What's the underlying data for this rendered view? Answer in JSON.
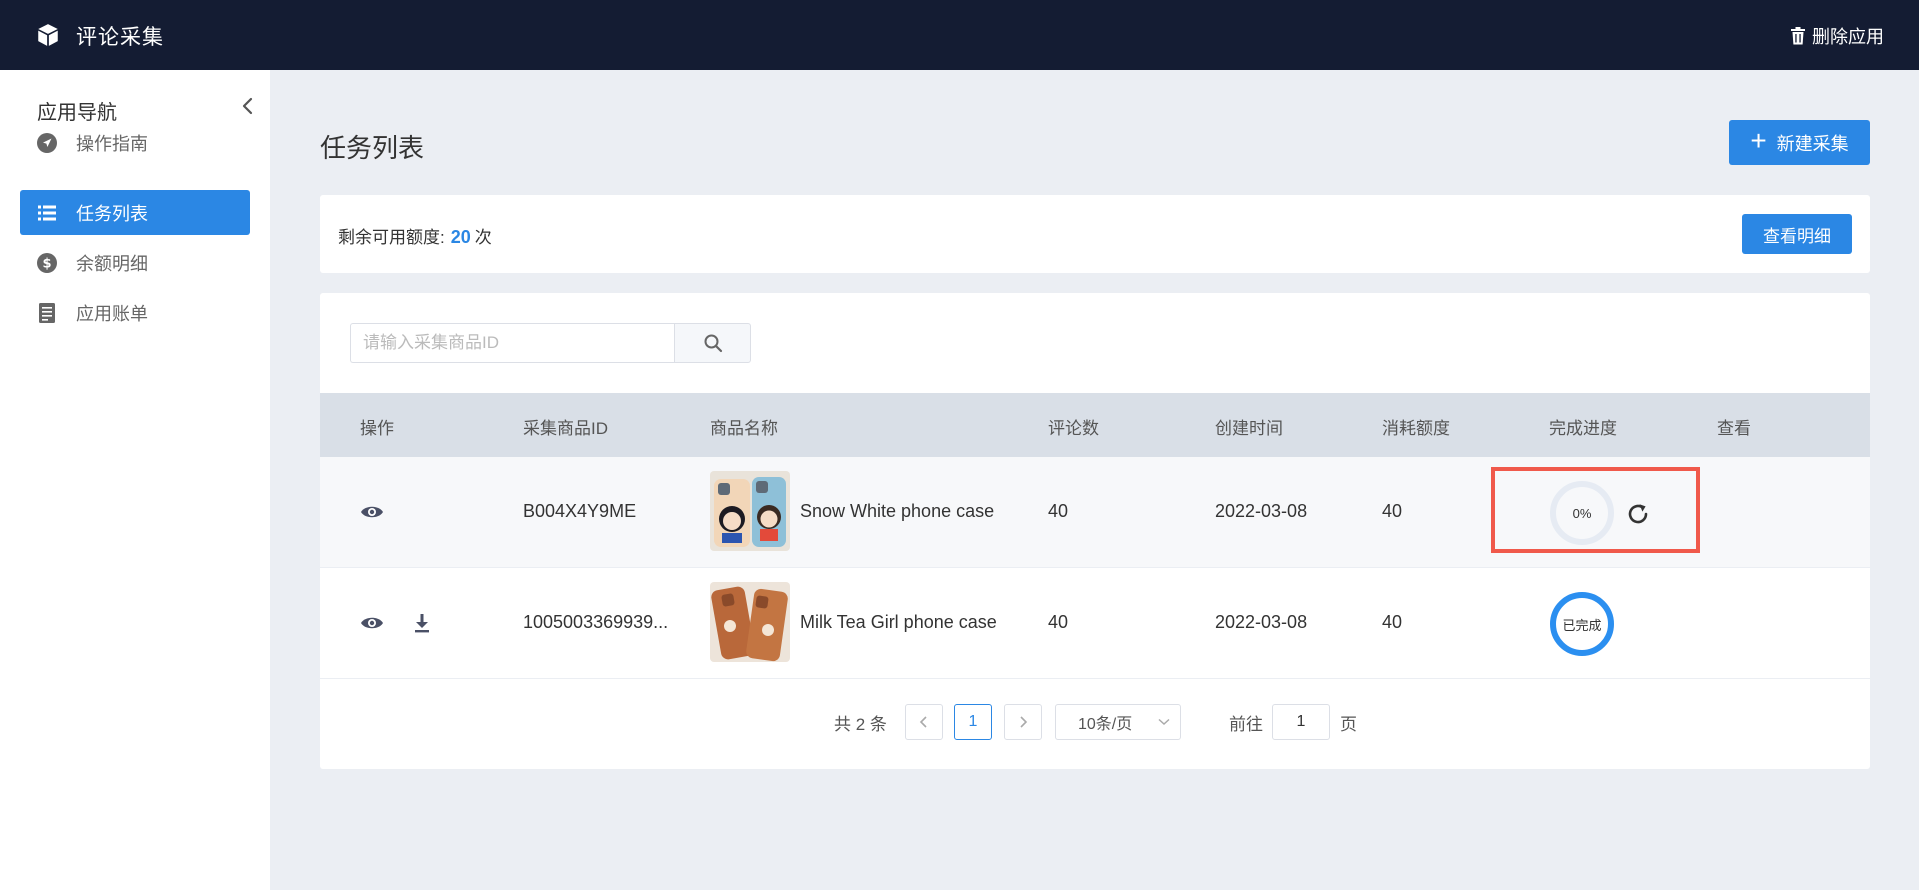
{
  "header": {
    "app_title": "评论采集",
    "delete_label": "删除应用",
    "logo_icon": "cube-icon"
  },
  "sidebar": {
    "title": "应用导航",
    "items": [
      {
        "label": "操作指南",
        "icon": "navigation-arrow-icon"
      },
      {
        "label": "任务列表",
        "icon": "list-icon",
        "active": true
      },
      {
        "label": "余额明细",
        "icon": "dollar-coin-icon"
      },
      {
        "label": "应用账单",
        "icon": "document-icon"
      }
    ]
  },
  "main": {
    "page_title": "任务列表",
    "new_button_label": "新建采集",
    "quota": {
      "label": "剩余可用额度:",
      "value": "20",
      "unit": "次",
      "detail_button": "查看明细"
    },
    "search": {
      "placeholder": "请输入采集商品ID",
      "value": ""
    },
    "table": {
      "columns": [
        "操作",
        "采集商品ID",
        "商品名称",
        "评论数",
        "创建时间",
        "消耗额度",
        "完成进度",
        "查看"
      ],
      "rows": [
        {
          "product_id": "B004X4Y9ME",
          "product_name": "Snow White phone case",
          "reviews": "40",
          "created": "2022-03-08",
          "cost": "40",
          "progress_label": "0%",
          "progress": 0,
          "actions": [
            "eye-icon"
          ]
        },
        {
          "product_id": "1005003369939...",
          "product_name": "Milk Tea Girl phone case",
          "reviews": "40",
          "created": "2022-03-08",
          "cost": "40",
          "progress_label": "已完成",
          "progress": 100,
          "actions": [
            "eye-icon",
            "download-icon"
          ]
        }
      ]
    },
    "pagination": {
      "total_label": "共 2 条",
      "current_page": "1",
      "page_size": "10条/页",
      "goto_label": "前往",
      "goto_value": "1",
      "page_unit": "页"
    }
  },
  "colors": {
    "header_bg": "#141c33",
    "accent": "#2b87e4",
    "highlight": "#f0594b"
  }
}
